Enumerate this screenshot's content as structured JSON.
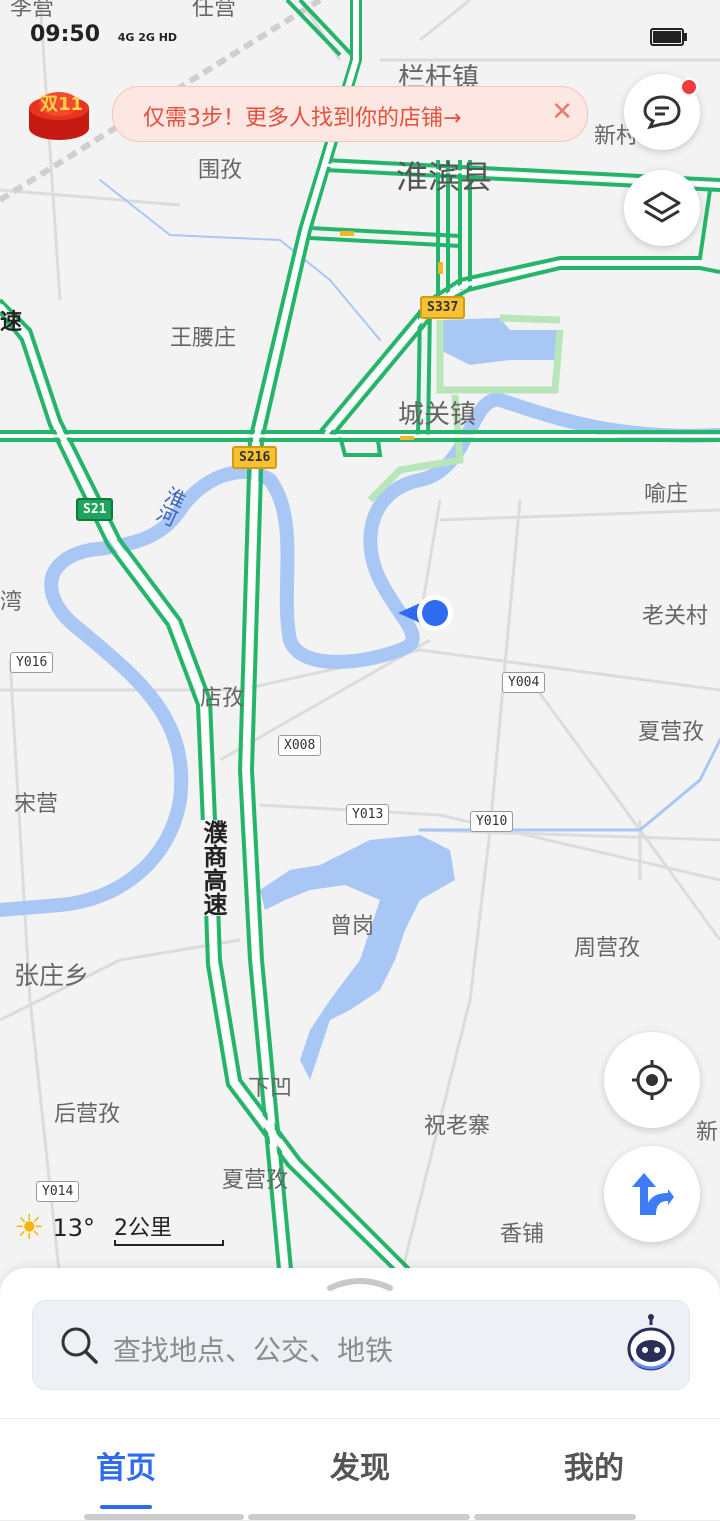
{
  "status_bar": {
    "time": "09:50",
    "signal": "4G 2G HD"
  },
  "promo": {
    "text": "仅需3步！更多人找到你的店铺→",
    "close": "✕",
    "badge": "双11"
  },
  "map": {
    "towns": {
      "lan_gan": "栏杆镇",
      "huaibin": "淮滨县",
      "wei_zi": "围孜",
      "xin": "新村",
      "wang_yao": "王腰庄",
      "cheng_guan": "城关镇",
      "yu_zhuang": "喻庄",
      "wan": "湾",
      "lao_guan": "老关村",
      "dian_zi": "店孜",
      "xia_ying_zi": "夏营孜",
      "song_ying": "宋营",
      "zeng_gang": "曾岗",
      "zhou_ying": "周营孜",
      "zhang_zhuang": "张庄乡",
      "xia_ao": "下凹",
      "hou_ying": "后营孜",
      "zhu_lao": "祝老寨",
      "xin2": "新",
      "xia_ying_zi2": "夏营孜",
      "xiang_pu": "香铺",
      "top1": "李营",
      "top2": "任营"
    },
    "rivers": {
      "huai": "淮河"
    },
    "highways": {
      "pu_shang": "濮商高速",
      "su": "速"
    },
    "badges": {
      "s337": "S337",
      "s216": "S216",
      "s21": "S21",
      "y016": "Y016",
      "y004": "Y004",
      "x008": "X008",
      "y013": "Y013",
      "y010": "Y010",
      "y014": "Y014"
    }
  },
  "weather": {
    "temp": "13°"
  },
  "scale": {
    "label": "2公里"
  },
  "search": {
    "placeholder": "查找地点、公交、地铁"
  },
  "tabs": {
    "home": "首页",
    "discover": "发现",
    "mine": "我的",
    "active": "home"
  },
  "colors": {
    "road": "#25b56a",
    "river": "#a9c7f5",
    "accent": "#2d6cf0",
    "promo_text": "#e4503c"
  }
}
